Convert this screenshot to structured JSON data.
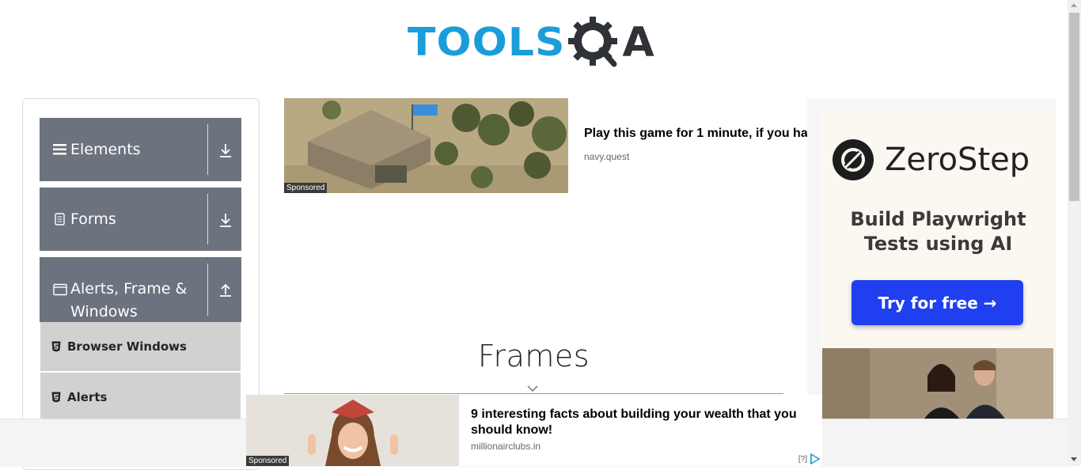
{
  "header": {
    "logo_text_left": "TOOLS",
    "logo_text_right": "A"
  },
  "sidebar": {
    "groups": [
      {
        "label": "Elements",
        "icon": "hamburger-icon",
        "arrow": "download-arrow-icon"
      },
      {
        "label": "Forms",
        "icon": "document-icon",
        "arrow": "download-arrow-icon"
      },
      {
        "label": "Alerts, Frame &\nWindows",
        "icon": "window-icon",
        "arrow": "upload-arrow-icon"
      }
    ],
    "sub_items": [
      {
        "label": "Browser Windows",
        "icon": "html5-icon"
      },
      {
        "label": "Alerts",
        "icon": "html5-icon"
      }
    ]
  },
  "ad_top": {
    "title": "Play this game for 1 minute, if you ha",
    "source": "navy.quest",
    "sponsored": "Sponsored"
  },
  "ad_right": {
    "brand": "ZeroStep",
    "headline_line1": "Build Playwright",
    "headline_line2": "Tests using AI",
    "cta": "Try for free →",
    "brand_color": "#1f3ff0"
  },
  "main": {
    "title": "Frames"
  },
  "ad_bottom": {
    "title": "9 interesting facts about building your wealth that you should know!",
    "source": "millionairclubs.in",
    "sponsored": "Sponsored",
    "adchoice": "[?]"
  },
  "colors": {
    "sidebar_group": "#6c737e",
    "sub_item": "#d1d1d1",
    "logo_blue": "#1b9dd9",
    "logo_dark": "#2f3236"
  }
}
